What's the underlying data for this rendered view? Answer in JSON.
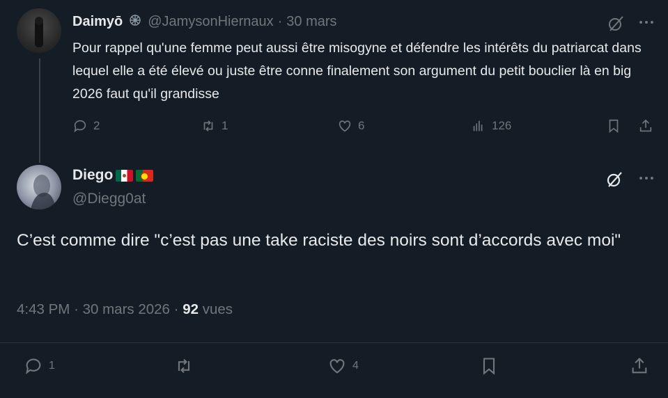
{
  "quoted_tweet": {
    "author_name": "Daimyō",
    "verified_icon": "badge-icon",
    "handle": "@JamysonHiernaux",
    "separator": "·",
    "date": "30 mars",
    "text": "Pour rappel qu'une femme peut aussi être misogyne et défendre les intérêts du patriarcat dans lequel elle a été élevé ou juste être conne finalement son argument du petit bouclier là en big 2026 faut qu'il grandisse",
    "replies": "2",
    "retweets": "1",
    "likes": "6",
    "views": "126"
  },
  "main_tweet": {
    "author_name": "Diego",
    "flags": [
      "mexico-flag",
      "portugal-flag"
    ],
    "handle": "@Diegg0at",
    "text": "C’est comme dire \"c’est pas une take raciste des noirs sont d’accords avec moi\"",
    "time": "4:43 PM",
    "sep1": "·",
    "date": "30 mars 2026",
    "sep2": "·",
    "views_count": "92",
    "views_label": "vues",
    "replies": "1",
    "likes": "4"
  },
  "colors": {
    "background": "#141d26",
    "text": "#e7e9ea",
    "muted": "#71767b",
    "divider": "#2f3336"
  }
}
